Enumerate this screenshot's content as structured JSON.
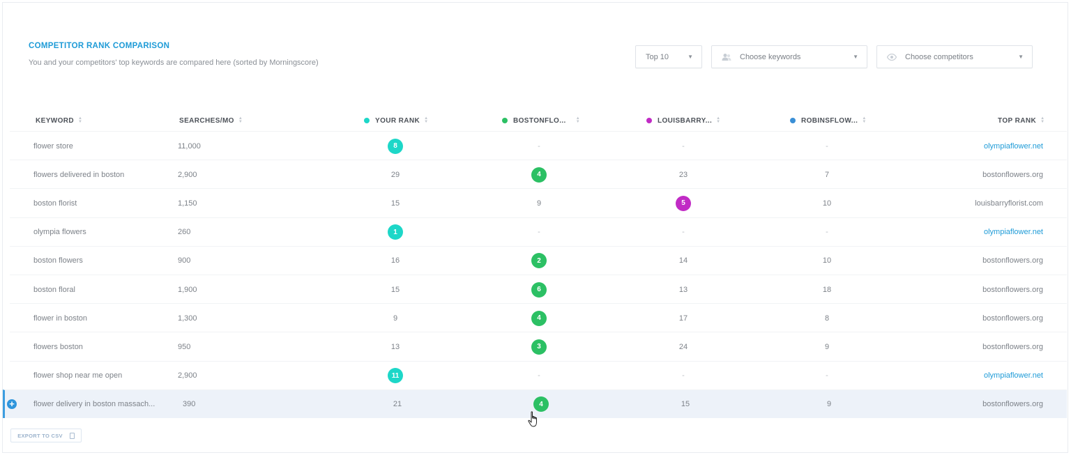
{
  "panel": {
    "title": "COMPETITOR RANK COMPARISON",
    "subtitle": "You and your competitors' top keywords are compared here (sorted by Morningscore)"
  },
  "filters": {
    "top": {
      "label": "Top 10",
      "icon": "chevron-down-icon"
    },
    "keywords": {
      "label": "Choose keywords",
      "icon": "users-icon"
    },
    "competitors": {
      "label": "Choose competitors",
      "icon": "eye-icon"
    }
  },
  "columns": {
    "keyword": "KEYWORD",
    "searches": "SEARCHES/MO",
    "your_rank": "YOUR RANK",
    "boston": "BOSTONFLO...",
    "louis": "LOUISBARRY...",
    "robins": "ROBINSFLOW...",
    "top_rank": "TOP RANK"
  },
  "colors": {
    "you": "#1dd7c8",
    "boston": "#2cc064",
    "louis": "#c12bc5",
    "robins": "#3a8fd6",
    "accent": "#1e9bd7"
  },
  "rows": [
    {
      "keyword": "flower store",
      "searches": "11,000",
      "you": "8",
      "boston": "-",
      "louis": "-",
      "robins": "-",
      "top": "olympiaflower.net",
      "best": "you",
      "link": true
    },
    {
      "keyword": "flowers delivered in boston",
      "searches": "2,900",
      "you": "29",
      "boston": "4",
      "louis": "23",
      "robins": "7",
      "top": "bostonflowers.org",
      "best": "boston",
      "link": false
    },
    {
      "keyword": "boston florist",
      "searches": "1,150",
      "you": "15",
      "boston": "9",
      "louis": "5",
      "robins": "10",
      "top": "louisbarryflorist.com",
      "best": "louis",
      "link": false
    },
    {
      "keyword": "olympia flowers",
      "searches": "260",
      "you": "1",
      "boston": "-",
      "louis": "-",
      "robins": "-",
      "top": "olympiaflower.net",
      "best": "you",
      "link": true
    },
    {
      "keyword": "boston flowers",
      "searches": "900",
      "you": "16",
      "boston": "2",
      "louis": "14",
      "robins": "10",
      "top": "bostonflowers.org",
      "best": "boston",
      "link": false
    },
    {
      "keyword": "boston floral",
      "searches": "1,900",
      "you": "15",
      "boston": "6",
      "louis": "13",
      "robins": "18",
      "top": "bostonflowers.org",
      "best": "boston",
      "link": false
    },
    {
      "keyword": "flower in boston",
      "searches": "1,300",
      "you": "9",
      "boston": "4",
      "louis": "17",
      "robins": "8",
      "top": "bostonflowers.org",
      "best": "boston",
      "link": false
    },
    {
      "keyword": "flowers boston",
      "searches": "950",
      "you": "13",
      "boston": "3",
      "louis": "24",
      "robins": "9",
      "top": "bostonflowers.org",
      "best": "boston",
      "link": false
    },
    {
      "keyword": "flower shop near me open",
      "searches": "2,900",
      "you": "11",
      "boston": "-",
      "louis": "-",
      "robins": "-",
      "top": "olympiaflower.net",
      "best": "you",
      "link": true
    },
    {
      "keyword": "flower delivery in boston massach...",
      "searches": "390",
      "you": "21",
      "boston": "4",
      "louis": "15",
      "robins": "9",
      "top": "bostonflowers.org",
      "best": "boston",
      "link": false,
      "highlighted": true
    }
  ],
  "export": {
    "label": "EXPORT TO CSV"
  }
}
